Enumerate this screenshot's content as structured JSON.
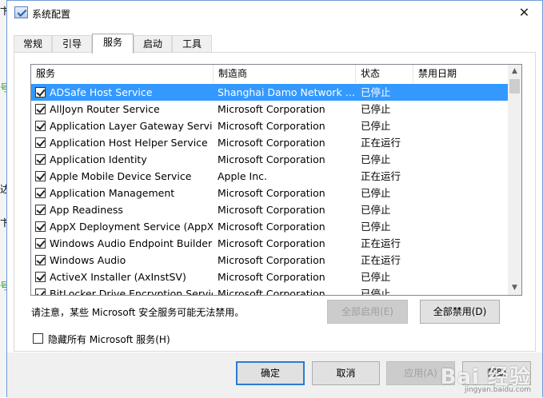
{
  "window": {
    "title": "系统配置",
    "close_glyph": "✕"
  },
  "tabs": [
    {
      "label": "常规"
    },
    {
      "label": "引导"
    },
    {
      "label": "服务"
    },
    {
      "label": "启动"
    },
    {
      "label": "工具"
    }
  ],
  "active_tab": "服务",
  "list": {
    "columns": [
      {
        "label": "服务"
      },
      {
        "label": "制造商"
      },
      {
        "label": "状态"
      },
      {
        "label": "禁用日期"
      }
    ],
    "rows": [
      {
        "name": "ADSafe Host Service",
        "manufacturer": "Shanghai Damo Network S...",
        "status": "已停止",
        "date": "",
        "checked": true,
        "selected": true
      },
      {
        "name": "AllJoyn Router Service",
        "manufacturer": "Microsoft Corporation",
        "status": "已停止",
        "date": "",
        "checked": true
      },
      {
        "name": "Application Layer Gateway Service",
        "manufacturer": "Microsoft Corporation",
        "status": "已停止",
        "date": "",
        "checked": true
      },
      {
        "name": "Application Host Helper Service",
        "manufacturer": "Microsoft Corporation",
        "status": "正在运行",
        "date": "",
        "checked": true
      },
      {
        "name": "Application Identity",
        "manufacturer": "Microsoft Corporation",
        "status": "已停止",
        "date": "",
        "checked": true
      },
      {
        "name": "Apple Mobile Device Service",
        "manufacturer": "Apple Inc.",
        "status": "正在运行",
        "date": "",
        "checked": true
      },
      {
        "name": "Application Management",
        "manufacturer": "Microsoft Corporation",
        "status": "已停止",
        "date": "",
        "checked": true
      },
      {
        "name": "App Readiness",
        "manufacturer": "Microsoft Corporation",
        "status": "已停止",
        "date": "",
        "checked": true
      },
      {
        "name": "AppX Deployment Service (AppX...",
        "manufacturer": "Microsoft Corporation",
        "status": "已停止",
        "date": "",
        "checked": true
      },
      {
        "name": "Windows Audio Endpoint Builder",
        "manufacturer": "Microsoft Corporation",
        "status": "正在运行",
        "date": "",
        "checked": true
      },
      {
        "name": "Windows Audio",
        "manufacturer": "Microsoft Corporation",
        "status": "正在运行",
        "date": "",
        "checked": true
      },
      {
        "name": "ActiveX Installer (AxInstSV)",
        "manufacturer": "Microsoft Corporation",
        "status": "已停止",
        "date": "",
        "checked": true
      },
      {
        "name": "BitLocker Drive Encryption Service",
        "manufacturer": "Microsoft Corporation",
        "status": "已停止",
        "date": "",
        "checked": true
      }
    ]
  },
  "note": "请注意，某些 Microsoft 安全服务可能无法禁用。",
  "buttons": {
    "enable_all": "全部启用(E)",
    "disable_all": "全部禁用(D)",
    "ok": "确定",
    "cancel": "取消",
    "apply": "应用(A)",
    "help": "帮助"
  },
  "hide_ms": {
    "label": "隐藏所有 Microsoft 服务(H)",
    "checked": false
  },
  "scrollbar": {
    "up_glyph": "▲",
    "down_glyph": "▼"
  },
  "watermark": {
    "text": "Bai 经验",
    "sub": "jingyan.baidu.com"
  },
  "page_edge": [
    "卞",
    "号",
    "达",
    "卞",
    "号"
  ]
}
